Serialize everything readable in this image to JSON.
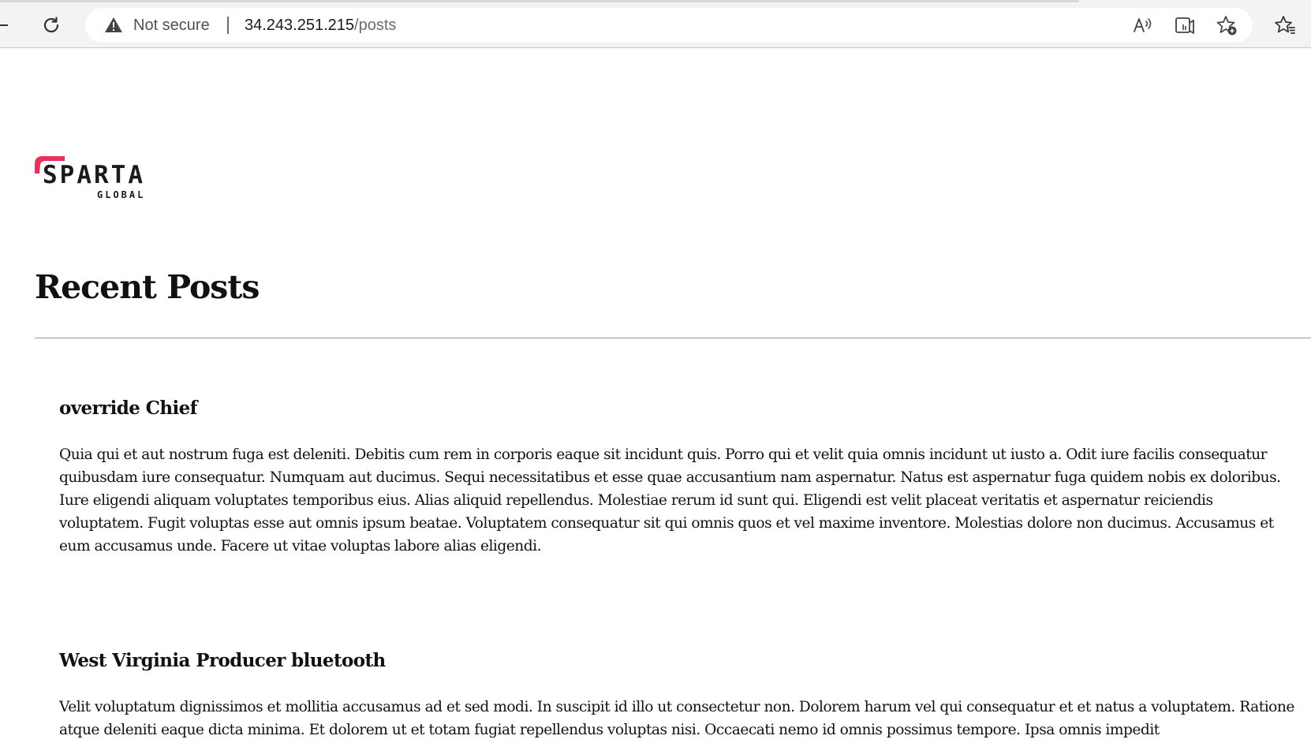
{
  "browser": {
    "security_label": "Not secure",
    "url_host": "34.243.251.215",
    "url_path": "/posts",
    "icons": [
      "refresh-icon",
      "warning-icon",
      "read-aloud-icon",
      "immersive-reader-icon",
      "add-favorite-icon",
      "favorites-icon"
    ]
  },
  "brand": {
    "logo_text": "SPARTA",
    "logo_subtext": "GLOBAL",
    "accent_color": "#e8305a"
  },
  "page": {
    "title": "Recent Posts"
  },
  "posts": [
    {
      "title": "override Chief",
      "body": "Quia qui et aut nostrum fuga est deleniti. Debitis cum rem in corporis eaque sit incidunt quis. Porro qui et velit quia omnis incidunt ut iusto a. Odit iure facilis consequatur quibusdam iure consequatur. Numquam aut ducimus. Sequi necessitatibus et esse quae accusantium nam aspernatur. Natus est aspernatur fuga quidem nobis ex doloribus. Iure eligendi aliquam voluptates temporibus eius. Alias aliquid repellendus. Molestiae rerum id sunt qui. Eligendi est velit placeat veritatis et aspernatur reiciendis voluptatem. Fugit voluptas esse aut omnis ipsum beatae. Voluptatem consequatur sit qui omnis quos et vel maxime inventore. Molestias dolore non ducimus. Accusamus et eum accusamus unde. Facere ut vitae voluptas labore alias eligendi."
    },
    {
      "title": "West Virginia Producer bluetooth",
      "body": "Velit voluptatum dignissimos et mollitia accusamus ad et sed modi. In suscipit id illo ut consectetur non. Dolorem harum vel qui consequatur et et natus a voluptatem. Ratione atque deleniti eaque dicta minima. Et dolorem ut et totam fugiat repellendus voluptas nisi. Occaecati nemo id omnis possimus tempore. Ipsa omnis impedit"
    }
  ]
}
